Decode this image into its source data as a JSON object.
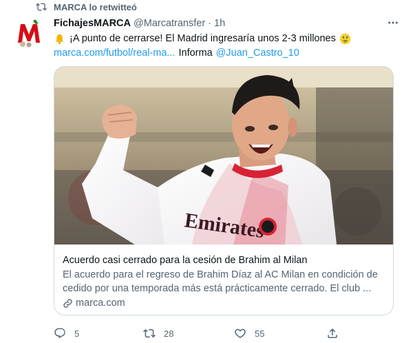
{
  "retweet": {
    "label": "MARCA lo retwitteó",
    "icon": "retweet-icon"
  },
  "author": {
    "name": "FichajesMARCA",
    "handle": "@Marcatransfer",
    "separator": "·",
    "time": "1h",
    "avatar": "marca-logo"
  },
  "tweet": {
    "bell_emoji": "bell-emoji",
    "text": "¡A punto de cerrarse! El Madrid ingresaría unos 2-3 millones",
    "money_emoji": "money-mouth-emoji",
    "link": "marca.com/futbol/real-ma...",
    "informa": "Informa",
    "mention": "@Juan_Castro_10"
  },
  "card": {
    "title": "Acuerdo casi cerrado para la cesión de Brahim al Milan",
    "description_line1": "El acuerdo para el regreso de Brahim Díaz al AC Milan en condición de",
    "description_line2": "cedido por una temporada más está prácticamente cerrado. El club ...",
    "domain": "marca.com",
    "shirt_text": "Emirates"
  },
  "actions": {
    "replies": "5",
    "retweets": "28",
    "likes": "55"
  },
  "colors": {
    "accent": "#1d9bf0",
    "secondary": "#536471",
    "border": "#cfd9de",
    "text": "#0f1419"
  }
}
